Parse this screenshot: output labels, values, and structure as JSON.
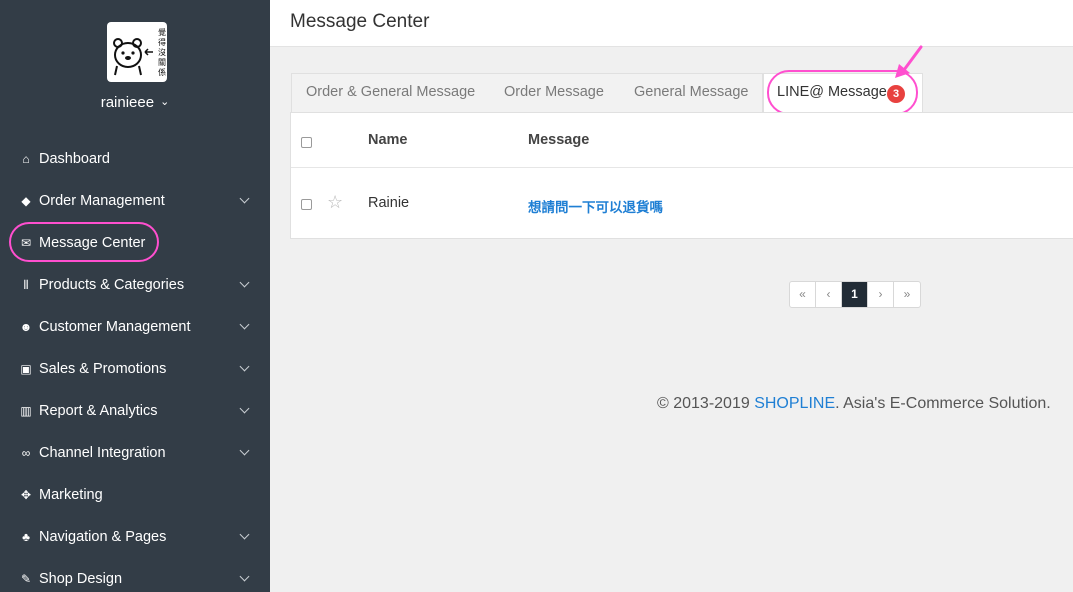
{
  "sidebar": {
    "username": "rainieee",
    "logo_text": "覺得沒關係",
    "items": [
      {
        "label": "Dashboard",
        "icon": "home-icon",
        "glyph": "⌂",
        "has_submenu": false
      },
      {
        "label": "Order Management",
        "icon": "tag-icon",
        "glyph": "◆",
        "has_submenu": true
      },
      {
        "label": "Message Center",
        "icon": "envelope-icon",
        "glyph": "✉",
        "has_submenu": false
      },
      {
        "label": "Products & Categories",
        "icon": "barcode-icon",
        "glyph": "⦀",
        "has_submenu": true
      },
      {
        "label": "Customer Management",
        "icon": "users-icon",
        "glyph": "☻",
        "has_submenu": true
      },
      {
        "label": "Sales & Promotions",
        "icon": "money-icon",
        "glyph": "▣",
        "has_submenu": true
      },
      {
        "label": "Report & Analytics",
        "icon": "chart-icon",
        "glyph": "▥",
        "has_submenu": true
      },
      {
        "label": "Channel Integration",
        "icon": "link-icon",
        "glyph": "∞",
        "has_submenu": true
      },
      {
        "label": "Marketing",
        "icon": "crosshair-icon",
        "glyph": "✥",
        "has_submenu": false
      },
      {
        "label": "Navigation & Pages",
        "icon": "sitemap-icon",
        "glyph": "♣",
        "has_submenu": true
      },
      {
        "label": "Shop Design",
        "icon": "magic-wand-icon",
        "glyph": "✎",
        "has_submenu": true
      }
    ]
  },
  "header": {
    "title": "Message Center"
  },
  "tabs": {
    "items": [
      "Order & General Message",
      "Order Message",
      "General Message"
    ],
    "active": "LINE@ Message",
    "active_badge": "3"
  },
  "table": {
    "columns": [
      "Name",
      "Message"
    ],
    "rows": [
      {
        "name": "Rainie",
        "message": "想請問一下可以退貨嗎"
      }
    ]
  },
  "pagination": {
    "first": "«",
    "prev": "‹",
    "current": "1",
    "next": "›",
    "last": "»"
  },
  "footer": {
    "copyright": "© 2013-2019 ",
    "brand": "SHOPLINE",
    "tagline": ". Asia's E-Commerce Solution."
  },
  "colors": {
    "sidebar_bg": "#333d47",
    "accent": "#1f7fd4",
    "highlight": "#ff4fcf",
    "badge": "#e8413f"
  }
}
